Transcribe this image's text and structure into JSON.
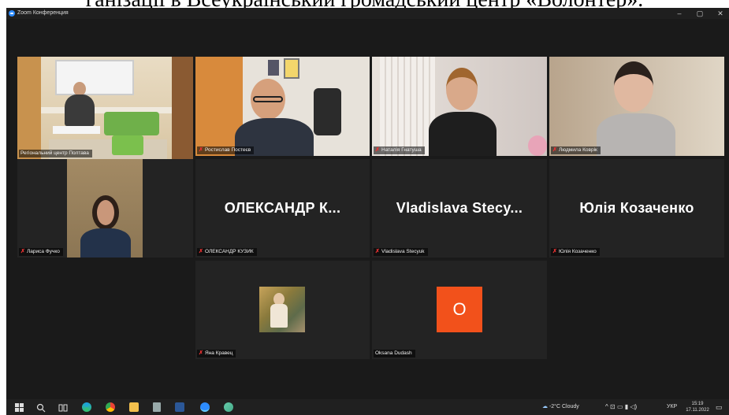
{
  "caption": "ганізації в Всеукраїнський громадський центр «Волонтер».",
  "window": {
    "title": "Zoom Конференция",
    "minimize": "–",
    "maximize": "▢",
    "close": "✕"
  },
  "participants": [
    {
      "name": "Регіональний центр Полтава",
      "video": true,
      "active": true,
      "muted": false
    },
    {
      "name": "Ростислав Постеєв",
      "video": true,
      "muted": true
    },
    {
      "name": "Наталія Гнатуша",
      "video": true,
      "muted": true
    },
    {
      "name": "Людмила Коврік",
      "video": true,
      "muted": true
    },
    {
      "name": "Лариса Фучко",
      "video": true,
      "muted": true
    },
    {
      "name": "ОЛЕКСАНДР КУЗИК",
      "display": "ОЛЕКСАНДР К...",
      "video": false,
      "muted": true
    },
    {
      "name": "Vladislava Stecyuk",
      "display": "Vladislava Stecy...",
      "video": false,
      "muted": true
    },
    {
      "name": "Юлія Козаченко",
      "display": "Юлія Козаченко",
      "video": false,
      "muted": true
    },
    {
      "name": "Яна Кравец",
      "video": false,
      "avatar": "photo",
      "muted": true
    },
    {
      "name": "Oksana Dudash",
      "video": false,
      "avatar": "letter",
      "avatar_letter": "O",
      "avatar_color": "#f2511b",
      "muted": false
    }
  ],
  "taskbar": {
    "weather": "-2°C Cloudy",
    "language": "УКР",
    "time": "15:19",
    "date": "17.11.2022",
    "icons": [
      "windows-start-icon",
      "search-icon",
      "task-view-icon",
      "edge-icon",
      "chrome-icon",
      "file-explorer-icon",
      "trash-icon",
      "word-icon",
      "zoom-icon",
      "paint-icon"
    ]
  },
  "colors": {
    "active_speaker": "#d9d36a",
    "tile_bg": "#232323",
    "oksana_avatar": "#f2511b"
  }
}
